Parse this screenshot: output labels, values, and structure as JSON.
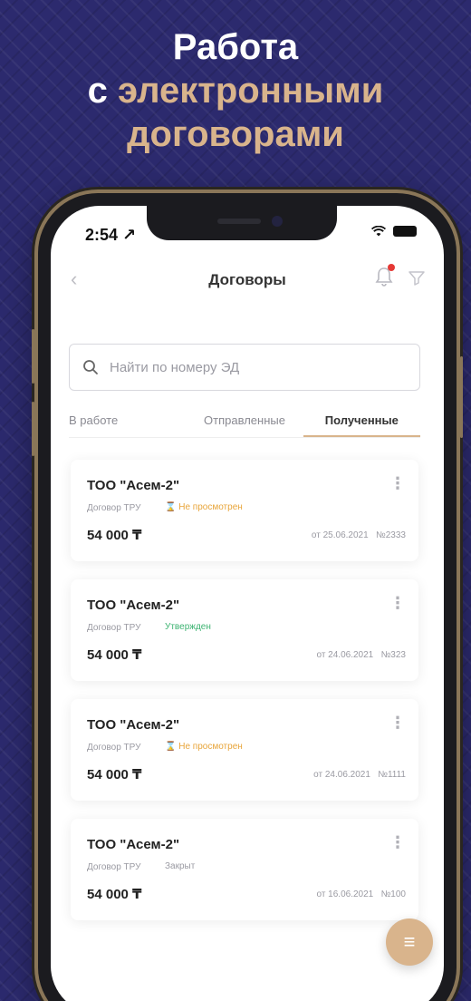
{
  "promo": {
    "line1": "Работа",
    "line2_prefix": "с",
    "line2_accent": "электронными",
    "line3": "договорами"
  },
  "status_bar": {
    "time": "2:54 ↗"
  },
  "header": {
    "title": "Договоры"
  },
  "search": {
    "placeholder": "Найти по номеру ЭД"
  },
  "tabs": [
    {
      "label": "В работе",
      "active": false
    },
    {
      "label": "Отправленные",
      "active": false
    },
    {
      "label": "Полученные",
      "active": true
    }
  ],
  "contracts": [
    {
      "company": "ТОО \"Асем-2\"",
      "type": "Договор ТРУ",
      "status": "Не просмотрен",
      "amount": "54 000 ₸",
      "date": "от 25.06.2021",
      "number": "№2333"
    },
    {
      "company": "ТОО \"Асем-2\"",
      "type": "Договор ТРУ",
      "status": "Утвержден",
      "amount": "54 000 ₸",
      "date": "от 24.06.2021",
      "number": "№323"
    },
    {
      "company": "ТОО \"Асем-2\"",
      "type": "Договор ТРУ",
      "status": "Не просмотрен",
      "amount": "54 000 ₸",
      "date": "от 24.06.2021",
      "number": "№1111"
    },
    {
      "company": "ТОО \"Асем-2\"",
      "type": "Договор ТРУ",
      "status": "Закрыт",
      "amount": "54 000 ₸",
      "date": "от 16.06.2021",
      "number": "№100"
    }
  ],
  "colors": {
    "accent": "#d9b48c",
    "status_new": "#e8a53a",
    "status_approved": "#3cb371",
    "status_closed": "#9a9aa2",
    "background": "#2c2a6e"
  },
  "icons": {
    "back": "chevron-left-icon",
    "bell": "bell-icon",
    "filter": "filter-icon",
    "search": "search-icon",
    "card_menu": "more-vertical-icon",
    "fab": "menu-icon"
  }
}
